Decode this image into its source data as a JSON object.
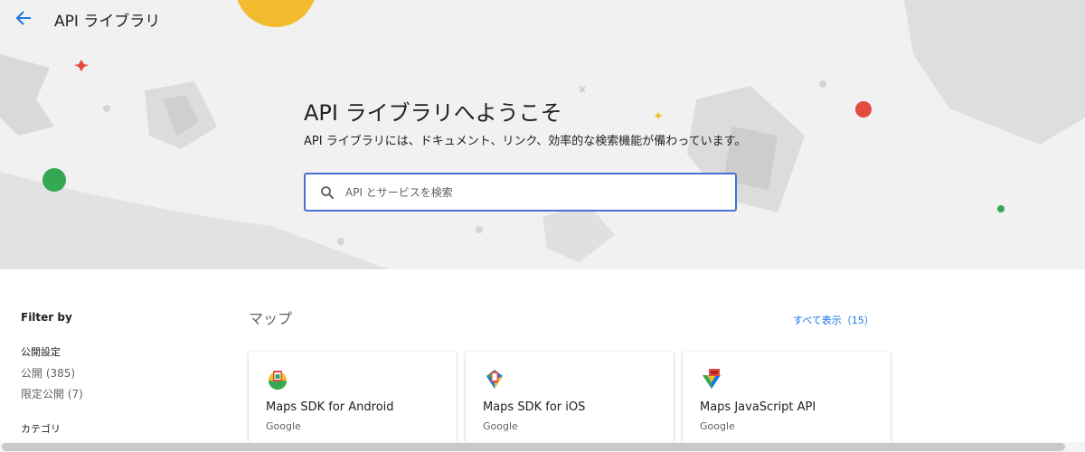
{
  "header": {
    "title": "API ライブラリ",
    "back_icon": "arrow-back-icon"
  },
  "hero": {
    "welcome": "API ライブラリへようこそ",
    "subtitle": "API ライブラリには、ドキュメント、リンク、効率的な検索機能が備わっています。",
    "search_placeholder": "API とサービスを検索",
    "search_value": ""
  },
  "sidebar": {
    "heading": "Filter by",
    "groups": [
      {
        "label": "公開設定",
        "options": [
          "公開 (385)",
          "限定公開 (7)"
        ]
      },
      {
        "label": "カテゴリ",
        "options": []
      }
    ]
  },
  "section": {
    "title": "マップ",
    "view_all": "すべて表示（15）",
    "cards": [
      {
        "title": "Maps SDK for Android",
        "vendor": "Google",
        "icon": "maps-android-icon"
      },
      {
        "title": "Maps SDK for iOS",
        "vendor": "Google",
        "icon": "maps-ios-icon"
      },
      {
        "title": "Maps JavaScript API",
        "vendor": "Google",
        "icon": "maps-javascript-icon"
      }
    ]
  },
  "colors": {
    "accent": "#1a73e8",
    "search_border": "#4a6fd1",
    "hero_bg": "#f1f1f1"
  }
}
